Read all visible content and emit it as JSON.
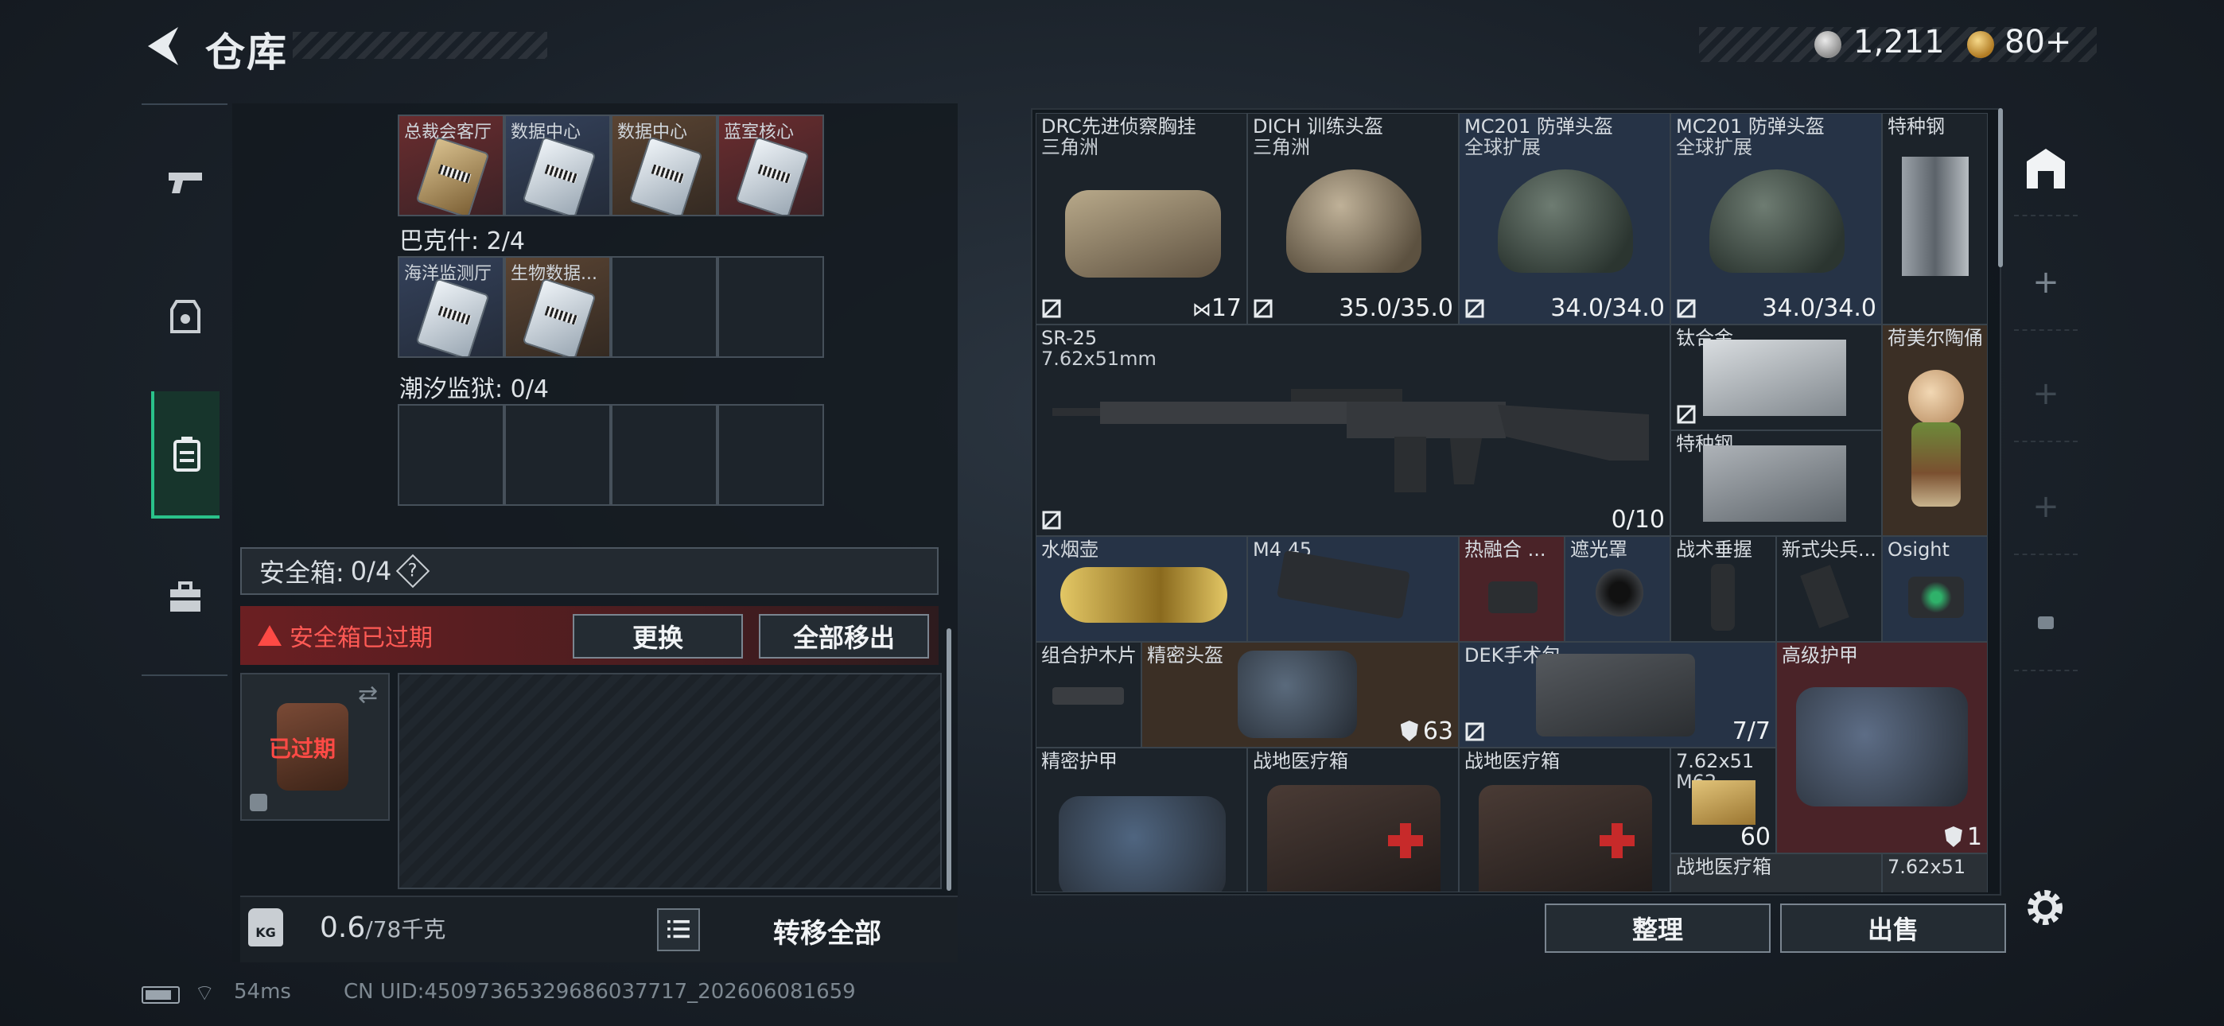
{
  "header": {
    "title": "仓库",
    "currency_silver": "1,211",
    "currency_gold": "80+"
  },
  "left": {
    "top_partial_labels": [
      "总裁会客厅",
      "数据中心",
      "数据中心",
      "蓝室核心"
    ],
    "group_bake": "巴克什: 2/4",
    "bake_items": [
      "海洋监测厅",
      "生物数据..."
    ],
    "group_chaoxi": "潮汐监狱: 0/4",
    "safe_label": "安全箱:",
    "safe_count": "0/4",
    "safe_help": "?",
    "expired_warning": "安全箱已过期",
    "btn_replace": "更换",
    "btn_move_all_out": "全部移出",
    "case_expired": "已过期",
    "weight_value": "0.6",
    "weight_max": "/78千克",
    "kg_label": "KG",
    "btn_transfer_all": "转移全部"
  },
  "stash": {
    "items": [
      {
        "name": "DRC先进侦察胸挂",
        "sub": "三角洲",
        "value": "17"
      },
      {
        "name": "DICH 训练头盔",
        "sub": "三角洲",
        "value": "35.0/35.0"
      },
      {
        "name": "MC201 防弹头盔",
        "sub": "全球扩展",
        "value": "34.0/34.0"
      },
      {
        "name": "MC201 防弹头盔",
        "sub": "全球扩展",
        "value": "34.0/34.0"
      },
      {
        "name": "特种钢"
      },
      {
        "name": "SR-25",
        "sub": "7.62x51mm",
        "value": "0/10"
      },
      {
        "name": "钛合金"
      },
      {
        "name": "荷美尔陶俑"
      },
      {
        "name": "特种钢"
      },
      {
        "name": "水烟壶"
      },
      {
        "name": "M4 45"
      },
      {
        "name": "热融合 ..."
      },
      {
        "name": "遮光罩"
      },
      {
        "name": "战术垂握"
      },
      {
        "name": "新式尖兵..."
      },
      {
        "name": "Osight"
      },
      {
        "name": "组合护木片"
      },
      {
        "name": "精密头盔",
        "value": "63"
      },
      {
        "name": "DEK手术包",
        "value": "7/7"
      },
      {
        "name": "高级护甲",
        "value": "1"
      },
      {
        "name": "精密护甲"
      },
      {
        "name": "战地医疗箱"
      },
      {
        "name": "战地医疗箱"
      },
      {
        "name": "7.62x51",
        "sub": "M62",
        "value": "60"
      },
      {
        "name": "战地医疗箱"
      },
      {
        "name": "7.62x51"
      }
    ]
  },
  "actions": {
    "sort": "整理",
    "sell": "出售"
  },
  "status": {
    "ping": "54ms",
    "uid": "CN UID:4509736532968603771​7_202606081659"
  },
  "colors": {
    "accent_green": "#2ac28a",
    "warning_red": "#ff4a45"
  }
}
